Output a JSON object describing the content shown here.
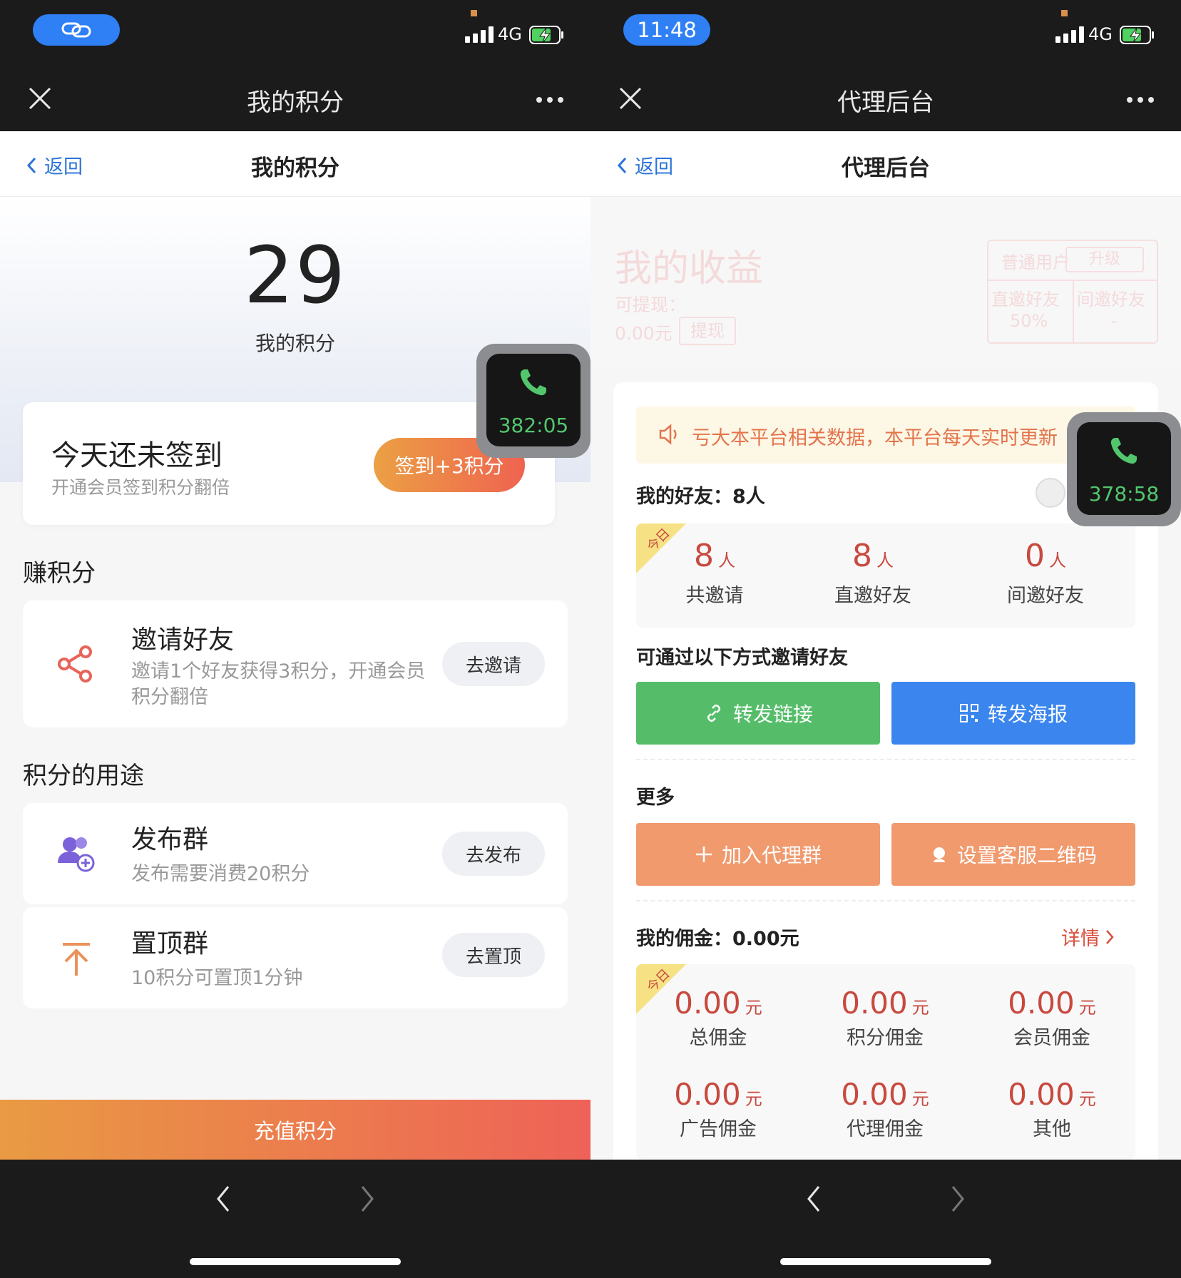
{
  "left": {
    "status": {
      "pill_icon": "link-icon",
      "network": "4G"
    },
    "nav_dark": {
      "title": "我的积分"
    },
    "nav_white": {
      "back": "返回",
      "title": "我的积分"
    },
    "points": {
      "value": "29",
      "label": "我的积分"
    },
    "signin": {
      "title": "今天还未签到",
      "subtitle": "开通会员签到积分翻倍",
      "button": "签到+3积分"
    },
    "call": {
      "time": "382:05"
    },
    "earn": {
      "title": "赚积分",
      "tasks": [
        {
          "name": "邀请好友",
          "desc": "邀请1个好友获得3积分，开通会员积分翻倍",
          "button": "去邀请",
          "icon": "share-icon"
        }
      ]
    },
    "use": {
      "title": "积分的用途",
      "tasks": [
        {
          "name": "发布群",
          "desc": "发布需要消费20积分",
          "button": "去发布",
          "icon": "add-group-icon"
        },
        {
          "name": "置顶群",
          "desc": "10积分可置顶1分钟",
          "button": "去置顶",
          "icon": "pin-top-icon"
        }
      ]
    },
    "recharge": "充值积分"
  },
  "right": {
    "status": {
      "time": "11:48",
      "network": "4G"
    },
    "nav_dark": {
      "title": "代理后台"
    },
    "nav_white": {
      "back": "返回",
      "title": "代理后台"
    },
    "earnings": {
      "title": "我的收益",
      "withdrawable_label": "可提现：",
      "withdrawable_value": "0.00元",
      "withdraw_button": "提现",
      "user_type": "普通用户",
      "upgrade": "升级",
      "col1": "直邀好友",
      "col2": "间邀好友",
      "val1": "50%",
      "val2": "-"
    },
    "call": {
      "time": "378:58"
    },
    "notice": "亏大本平台相关数据，本平台每天实时更新",
    "friends": {
      "label": "我的好友：",
      "count": "8人"
    },
    "ribbon": "今日",
    "invite_stats": [
      {
        "value": "8",
        "unit": "人",
        "label": "共邀请"
      },
      {
        "value": "8",
        "unit": "人",
        "label": "直邀好友"
      },
      {
        "value": "0",
        "unit": "人",
        "label": "间邀好友"
      }
    ],
    "invite_title": "可通过以下方式邀请好友",
    "share_link": "转发链接",
    "share_poster": "转发海报",
    "more_title": "更多",
    "join_group": "加入代理群",
    "set_qr": "设置客服二维码",
    "commission": {
      "label": "我的佣金：",
      "value": "0.00元",
      "detail": "详情"
    },
    "commission_stats": [
      {
        "value": "0.00",
        "unit": "元",
        "label": "总佣金"
      },
      {
        "value": "0.00",
        "unit": "元",
        "label": "积分佣金"
      },
      {
        "value": "0.00",
        "unit": "元",
        "label": "会员佣金"
      },
      {
        "value": "0.00",
        "unit": "元",
        "label": "广告佣金"
      },
      {
        "value": "0.00",
        "unit": "元",
        "label": "代理佣金"
      },
      {
        "value": "0.00",
        "unit": "元",
        "label": "其他"
      }
    ],
    "colors": {
      "accent_red": "#c8493e",
      "green_btn": "#55bd69",
      "blue_btn": "#3a86ee",
      "orange_btn": "#f09a6e"
    }
  }
}
